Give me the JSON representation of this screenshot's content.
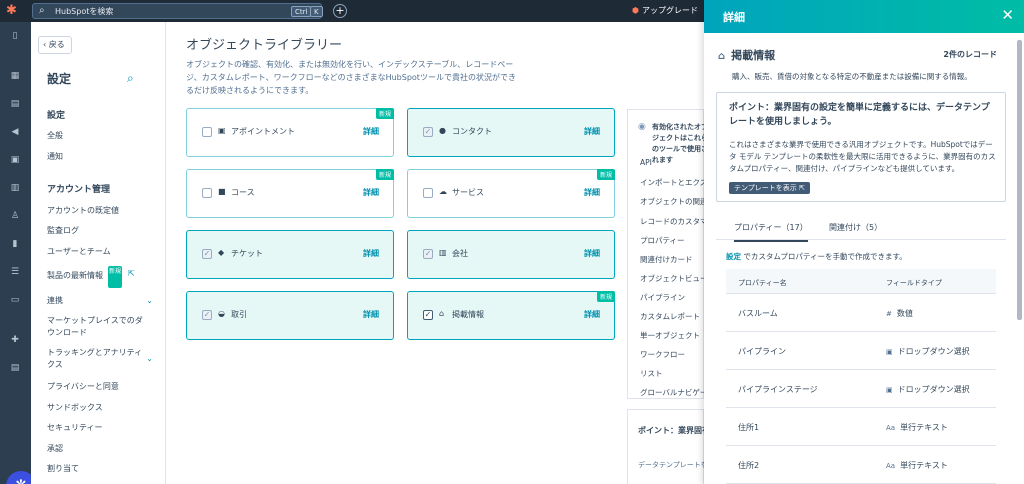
{
  "topbar": {
    "logo_icon": "hubspot-sprocket-icon",
    "search_placeholder": "HubSpotを検索",
    "kbd_ctrl": "Ctrl",
    "kbd_k": "K",
    "upgrade_label": "アップグレード"
  },
  "nav": {
    "back_label": "戻る",
    "title": "設定",
    "items": [
      {
        "label": "設定",
        "heading": true
      },
      {
        "label": "全般"
      },
      {
        "label": "通知"
      },
      {
        "label": "アカウント管理",
        "heading": true
      },
      {
        "label": "アカウントの既定値"
      },
      {
        "label": "監査ログ"
      },
      {
        "label": "ユーザーとチーム"
      },
      {
        "label": "製品の最新情報"
      },
      {
        "label": "連携"
      },
      {
        "label": "マーケットプレイスでのダウンロード"
      },
      {
        "label": "トラッキングとアナリティクス"
      },
      {
        "label": "プライバシーと同意"
      },
      {
        "label": "サンドボックス"
      },
      {
        "label": "セキュリティー"
      },
      {
        "label": "承認"
      },
      {
        "label": "割り当て"
      }
    ],
    "new_badge": "新規"
  },
  "main": {
    "title": "オブジェクトライブラリー",
    "description": "オブジェクトの確認、有効化、または無効化を行い、インデックステーブル、レコードページ、カスタムレポート、ワークフローなどのさまざまなHubSpotツールで貴社の状況ができるだけ反映されるようにできます。",
    "detail_label": "詳細",
    "new_label": "新規",
    "cards": [
      {
        "label": "アポイントメント",
        "icon": "calendar-icon",
        "enabled": false,
        "new": true
      },
      {
        "label": "コンタクト",
        "icon": "person-icon",
        "enabled": true,
        "new": false
      },
      {
        "label": "コース",
        "icon": "book-icon",
        "enabled": false,
        "new": true
      },
      {
        "label": "サービス",
        "icon": "cloud-icon",
        "enabled": false,
        "new": true
      },
      {
        "label": "チケット",
        "icon": "ticket-icon",
        "enabled": true,
        "new": false
      },
      {
        "label": "会社",
        "icon": "building-icon",
        "enabled": true,
        "new": false
      },
      {
        "label": "取引",
        "icon": "handshake-icon",
        "enabled": true,
        "new": false
      },
      {
        "label": "掲載情報",
        "icon": "house-icon",
        "enabled": true,
        "new": true
      }
    ],
    "side_panel": {
      "title": "有効化されたオブジェクトはこれらのツールで使用されます",
      "items": [
        "API",
        "インポートとエクスポート",
        "オブジェクトの関連付け",
        "レコードのカスタマイズ",
        "プロパティー",
        "関連付けカード",
        "オブジェクトビュー",
        "パイプライン",
        "カスタムレポート",
        "単一オブジェクト",
        "ワークフロー",
        "リスト",
        "グローバルナビゲーション"
      ]
    },
    "tip_panel": {
      "title": "ポイント：業界固有の設定を簡単に定義するには、データテンプレートを使用しましょう。",
      "desc": "データテンプレートを使用して業界固有のデータモデルを作成するためのテンプレートを設定できます。"
    }
  },
  "drawer": {
    "title": "詳細",
    "object_name": "掲載情報",
    "record_count": "2件のレコード",
    "description": "購入、販売、賃借の対象となる特定の不動産または設備に関する情報。",
    "tip_title": "ポイント：業界固有の設定を簡単に定義するには、データテンプレートを使用しましょう。",
    "tip_body": "これはさまざまな業界で使用できる汎用オブジェクトです。HubSpotではデータ モデル テンプレートの柔軟性を最大限に活用できるように、業界固有のカスタムプロパティー、関連付け、パイプラインなども提供しています。",
    "tip_button": "テンプレートを表示",
    "tabs": [
      {
        "label": "プロパティー（17）",
        "active": true
      },
      {
        "label": "関連付け（5）",
        "active": false
      }
    ],
    "note_link": "設定",
    "note_text": " でカスタムプロパティーを手動で作成できます。",
    "table": {
      "headers": [
        "プロパティー名",
        "フィールドタイプ"
      ],
      "rows": [
        {
          "name": "バスルーム",
          "type": "数値",
          "type_icon": "hash-icon"
        },
        {
          "name": "パイプライン",
          "type": "ドロップダウン選択",
          "type_icon": "dropdown-icon"
        },
        {
          "name": "パイプラインステージ",
          "type": "ドロップダウン選択",
          "type_icon": "dropdown-icon"
        },
        {
          "name": "住所1",
          "type": "単行テキスト",
          "type_icon": "text-icon"
        },
        {
          "name": "住所2",
          "type": "単行テキスト",
          "type_icon": "text-icon"
        }
      ]
    }
  }
}
